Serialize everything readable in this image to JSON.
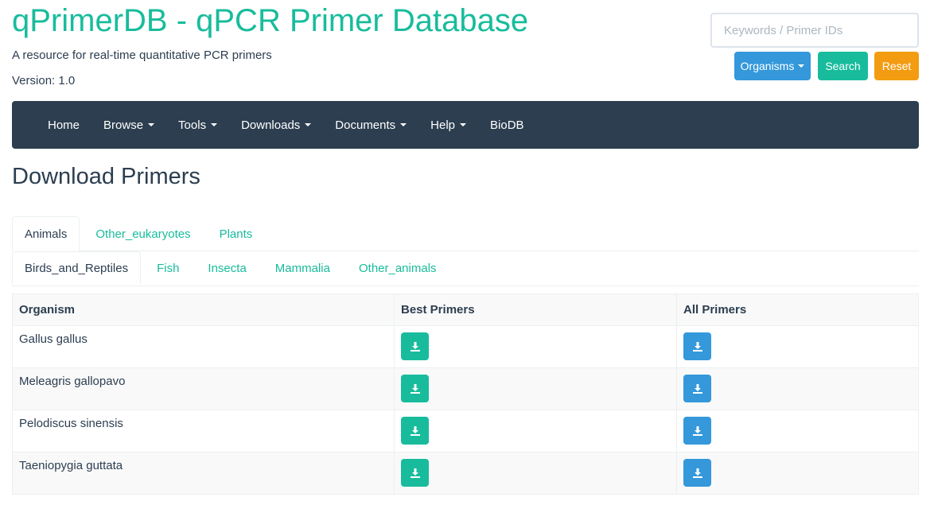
{
  "header": {
    "title": "qPrimerDB - qPCR Primer Database",
    "subtitle": "A resource for real-time quantitative PCR primers",
    "version": "Version: 1.0"
  },
  "search": {
    "placeholder": "Keywords / Primer IDs",
    "organisms_label": "Organisms",
    "search_label": "Search",
    "reset_label": "Reset"
  },
  "nav": {
    "items": [
      {
        "label": "Home"
      },
      {
        "label": "Browse"
      },
      {
        "label": "Tools"
      },
      {
        "label": "Downloads"
      },
      {
        "label": "Documents"
      },
      {
        "label": "Help"
      },
      {
        "label": "BioDB"
      }
    ]
  },
  "page": {
    "heading": "Download Primers"
  },
  "tabs": {
    "level1": [
      {
        "label": "Animals"
      },
      {
        "label": "Other_eukaryotes"
      },
      {
        "label": "Plants"
      }
    ],
    "level2": [
      {
        "label": "Birds_and_Reptiles"
      },
      {
        "label": "Fish"
      },
      {
        "label": "Insecta"
      },
      {
        "label": "Mammalia"
      },
      {
        "label": "Other_animals"
      }
    ]
  },
  "table": {
    "headers": [
      "Organism",
      "Best Primers",
      "All Primers"
    ],
    "rows": [
      {
        "organism": "Gallus gallus"
      },
      {
        "organism": "Meleagris gallopavo"
      },
      {
        "organism": "Pelodiscus sinensis"
      },
      {
        "organism": "Taeniopygia guttata"
      }
    ],
    "download_icon": "download-icon"
  },
  "colors": {
    "accent": "#18bc9c",
    "primary": "#3498db",
    "warning": "#f39c12",
    "navbar": "#2c3e50"
  }
}
